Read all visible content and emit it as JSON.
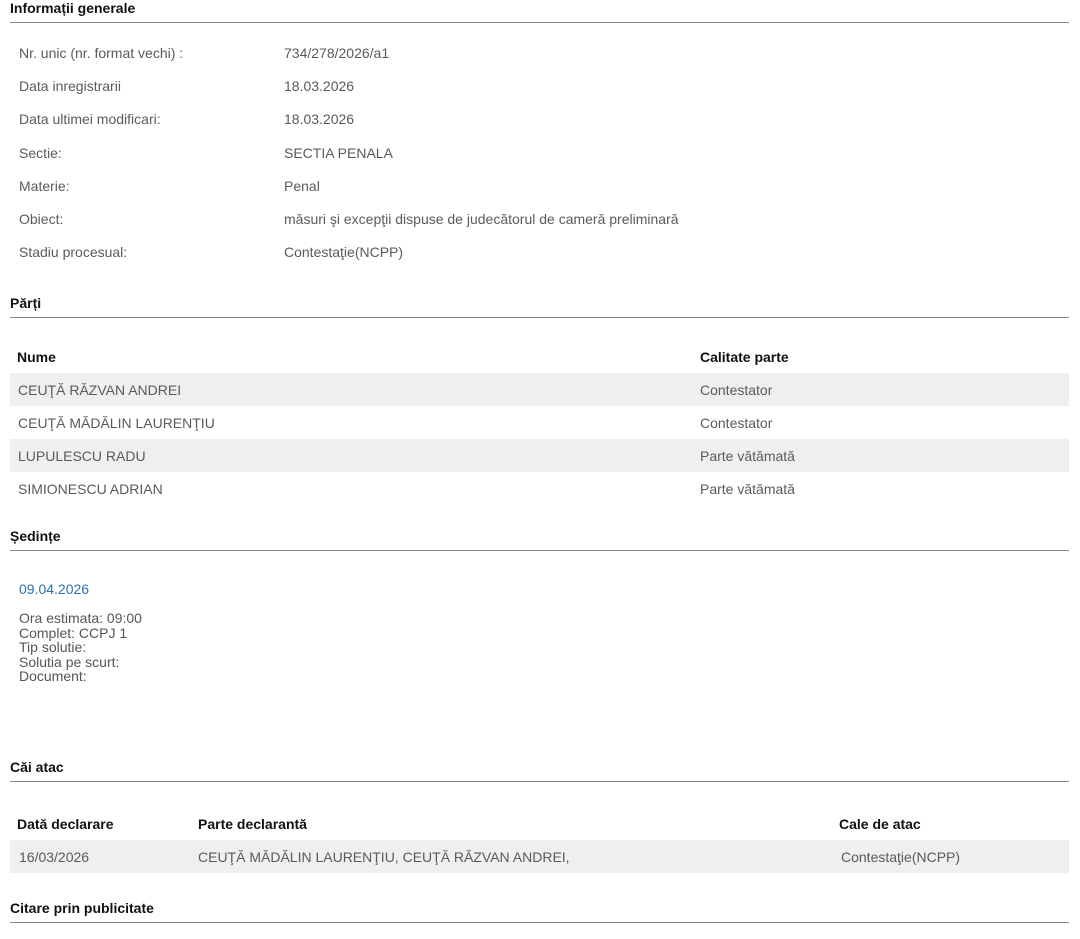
{
  "info": {
    "title": "Informații generale",
    "rows": [
      {
        "label": "Nr. unic (nr. format vechi) :",
        "value": "734/278/2026/a1"
      },
      {
        "label": "Data inregistrarii",
        "value": "18.03.2026"
      },
      {
        "label": "Data ultimei modificari:",
        "value": "18.03.2026"
      },
      {
        "label": "Sectie:",
        "value": "SECTIA PENALA"
      },
      {
        "label": "Materie:",
        "value": "Penal"
      },
      {
        "label": "Obiect:",
        "value": "măsuri şi excepţii dispuse de judecătorul de cameră preliminară"
      },
      {
        "label": "Stadiu procesual:",
        "value": "Contestaţie(NCPP)"
      }
    ]
  },
  "parti": {
    "title": "Părți",
    "headers": {
      "name": "Nume",
      "role": "Calitate parte"
    },
    "rows": [
      {
        "name": "CEUŢĂ RĂZVAN ANDREI",
        "role": "Contestator"
      },
      {
        "name": "CEUŢĂ MĂDĂLIN LAURENŢIU",
        "role": "Contestator"
      },
      {
        "name": "LUPULESCU RADU",
        "role": "Parte vătămată"
      },
      {
        "name": "SIMIONESCU ADRIAN",
        "role": "Parte vătămată"
      }
    ]
  },
  "sedinte": {
    "title": "Ședințe",
    "date": "09.04.2026",
    "details": [
      "Ora estimata: 09:00",
      "Complet: CCPJ 1",
      "Tip solutie:",
      "Solutia pe scurt:",
      "Document:"
    ]
  },
  "cai_atac": {
    "title": "Căi atac",
    "headers": {
      "date": "Dată declarare",
      "party": "Parte declarantă",
      "type": "Cale de atac"
    },
    "rows": [
      {
        "date": "16/03/2026",
        "party": "CEUŢĂ MĂDĂLIN LAURENŢIU, CEUŢĂ RĂZVAN ANDREI,",
        "type": "Contestaţie(NCPP)"
      }
    ]
  },
  "citare": {
    "title": "Citare prin publicitate"
  }
}
